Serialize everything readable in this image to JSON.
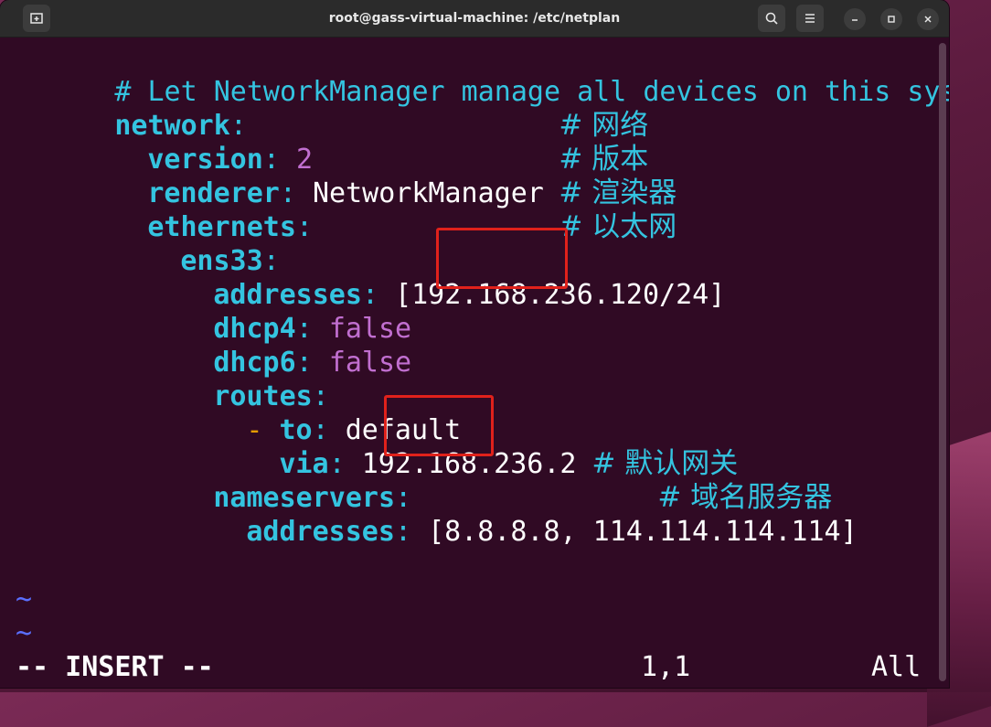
{
  "window": {
    "title": "root@gass-virtual-machine: /etc/netplan"
  },
  "titlebar": {
    "new_tab_icon": "new-tab-icon",
    "search_icon": "search-icon",
    "menu_icon": "hamburger-menu-icon",
    "minimize_icon": "minimize-icon",
    "maximize_icon": "maximize-icon",
    "close_icon": "close-icon"
  },
  "editor": {
    "line1": "# Let NetworkManager manage all devices on this system",
    "network_key": "network",
    "network_comment": "# 网络",
    "version_key": "version",
    "version_value": "2",
    "version_comment": "# 版本",
    "renderer_key": "renderer",
    "renderer_value": "NetworkManager",
    "renderer_comment": "# 渲染器",
    "ethernets_key": "ethernets",
    "ethernets_comment": "# 以太网",
    "iface_key": "ens33",
    "addresses_key": "addresses",
    "addresses_value": "[192.168.236.120/24]",
    "dhcp4_key": "dhcp4",
    "dhcp4_value": "false",
    "dhcp6_key": "dhcp6",
    "dhcp6_value": "false",
    "routes_key": "routes",
    "to_key": "to",
    "to_value": "default",
    "via_key": "via",
    "via_value": "192.168.236.2",
    "via_comment": "# 默认网关",
    "nameservers_key": "nameservers",
    "nameservers_comment": "# 域名服务器",
    "ns_addresses_key": "addresses",
    "ns_addresses_value": "[8.8.8.8, 114.114.114.114]",
    "tilde": "~"
  },
  "statusline": {
    "mode": "-- INSERT --",
    "position": "1,1",
    "scroll": "All"
  },
  "colors": {
    "key": "#34c4e0",
    "number": "#c16fd0",
    "highlight_box": "#e0211b",
    "background": "#300a24"
  }
}
